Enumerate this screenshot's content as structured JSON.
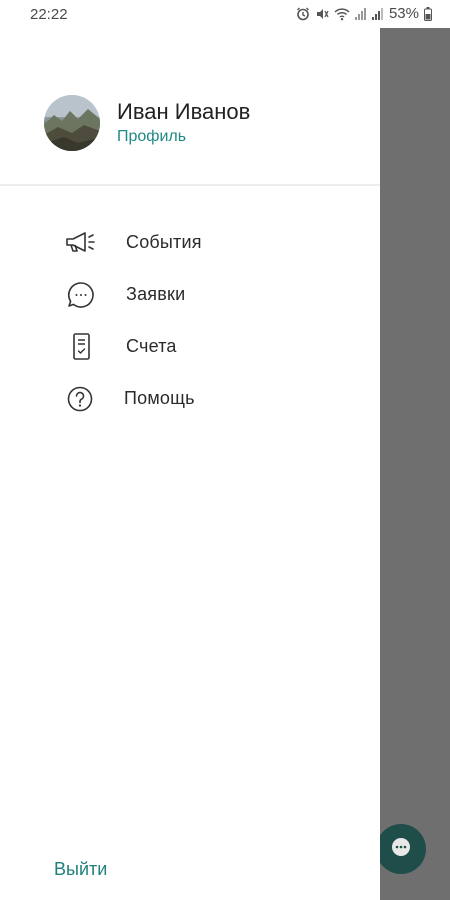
{
  "status_bar": {
    "time": "22:22",
    "battery": "53%",
    "icons": [
      "alarm-icon",
      "mute-icon",
      "wifi-icon",
      "signal-icon",
      "signal-icon",
      "battery-icon"
    ]
  },
  "profile": {
    "name": "Иван Иванов",
    "link": "Профиль"
  },
  "menu": {
    "items": [
      {
        "label": "События",
        "icon": "megaphone-icon"
      },
      {
        "label": "Заявки",
        "icon": "chat-bubble-icon"
      },
      {
        "label": "Счета",
        "icon": "invoice-icon"
      },
      {
        "label": "Помощь",
        "icon": "help-icon"
      }
    ]
  },
  "footer": {
    "logout": "Выйти"
  },
  "colors": {
    "accent": "#1f8a86",
    "scrim": "#6f6f6f",
    "fab": "#1f4d4a"
  }
}
